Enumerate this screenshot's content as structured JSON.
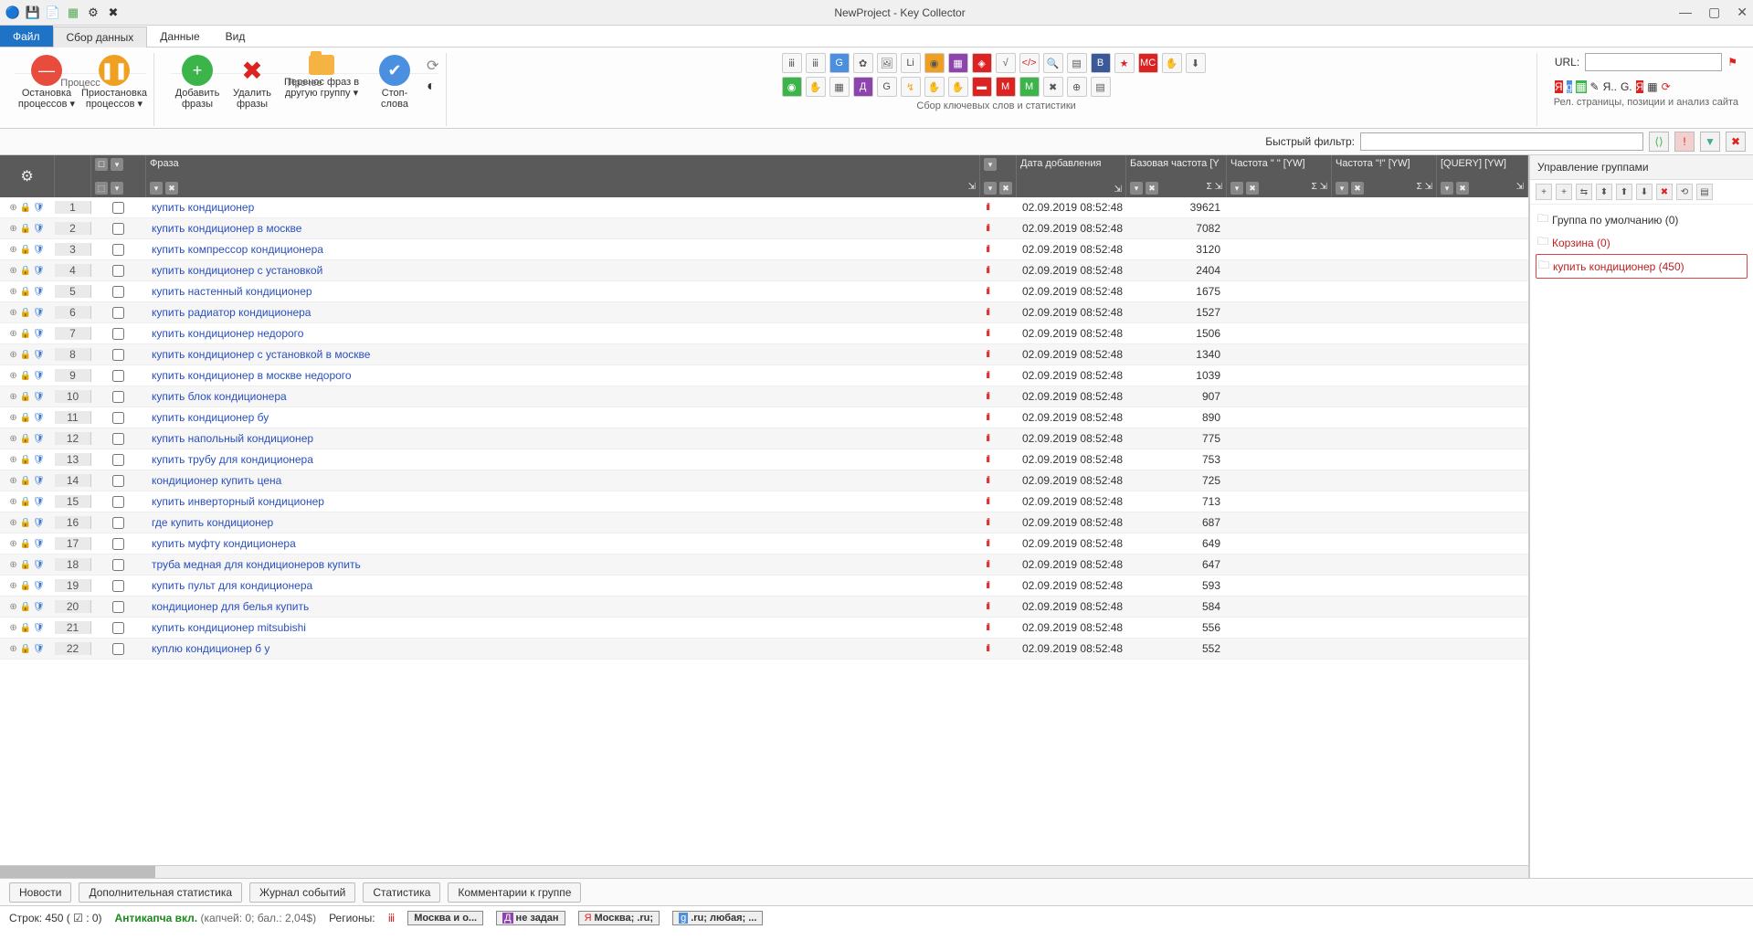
{
  "window": {
    "title": "NewProject - Key Collector"
  },
  "ribbonTabs": {
    "file": "Файл",
    "collect": "Сбор данных",
    "data": "Данные",
    "view": "Вид"
  },
  "ribbon": {
    "process": {
      "stop": "Остановка процессов ▾",
      "pause": "Приостановка процессов ▾",
      "caption": "Процесс"
    },
    "other": {
      "add": "Добавить фразы",
      "del": "Удалить фразы",
      "move": "Перенос фраз в другую группу ▾",
      "stop": "Стоп-слова",
      "caption": "Прочее"
    },
    "keywords_caption": "Сбор ключевых слов и статистики",
    "url_label": "URL:",
    "url_caption": "Рел. страницы, позиции и анализ сайта"
  },
  "filter": {
    "label": "Быстрый фильтр:"
  },
  "columns": {
    "phrase": "Фраза",
    "date": "Дата добавления",
    "base": "Базовая частота [Y",
    "f1": "Частота \" \" [YW]",
    "f2": "Частота \"!\" [YW]",
    "query": "[QUERY] [YW]"
  },
  "rows": [
    {
      "n": 1,
      "phrase": "купить кондиционер",
      "date": "02.09.2019 08:52:48",
      "base": 39621
    },
    {
      "n": 2,
      "phrase": "купить кондиционер в москве",
      "date": "02.09.2019 08:52:48",
      "base": 7082
    },
    {
      "n": 3,
      "phrase": "купить компрессор кондиционера",
      "date": "02.09.2019 08:52:48",
      "base": 3120
    },
    {
      "n": 4,
      "phrase": "купить кондиционер с установкой",
      "date": "02.09.2019 08:52:48",
      "base": 2404
    },
    {
      "n": 5,
      "phrase": "купить настенный кондиционер",
      "date": "02.09.2019 08:52:48",
      "base": 1675
    },
    {
      "n": 6,
      "phrase": "купить радиатор кондиционера",
      "date": "02.09.2019 08:52:48",
      "base": 1527
    },
    {
      "n": 7,
      "phrase": "купить кондиционер недорого",
      "date": "02.09.2019 08:52:48",
      "base": 1506
    },
    {
      "n": 8,
      "phrase": "купить кондиционер с установкой в москве",
      "date": "02.09.2019 08:52:48",
      "base": 1340
    },
    {
      "n": 9,
      "phrase": "купить кондиционер в москве недорого",
      "date": "02.09.2019 08:52:48",
      "base": 1039
    },
    {
      "n": 10,
      "phrase": "купить блок кондиционера",
      "date": "02.09.2019 08:52:48",
      "base": 907
    },
    {
      "n": 11,
      "phrase": "купить кондиционер бу",
      "date": "02.09.2019 08:52:48",
      "base": 890
    },
    {
      "n": 12,
      "phrase": "купить напольный кондиционер",
      "date": "02.09.2019 08:52:48",
      "base": 775
    },
    {
      "n": 13,
      "phrase": "купить трубу для кондиционера",
      "date": "02.09.2019 08:52:48",
      "base": 753
    },
    {
      "n": 14,
      "phrase": "кондиционер купить цена",
      "date": "02.09.2019 08:52:48",
      "base": 725
    },
    {
      "n": 15,
      "phrase": "купить инверторный кондиционер",
      "date": "02.09.2019 08:52:48",
      "base": 713
    },
    {
      "n": 16,
      "phrase": "где купить кондиционер",
      "date": "02.09.2019 08:52:48",
      "base": 687
    },
    {
      "n": 17,
      "phrase": "купить муфту кондиционера",
      "date": "02.09.2019 08:52:48",
      "base": 649
    },
    {
      "n": 18,
      "phrase": "труба медная для кондиционеров купить",
      "date": "02.09.2019 08:52:48",
      "base": 647
    },
    {
      "n": 19,
      "phrase": "купить пульт для кондиционера",
      "date": "02.09.2019 08:52:48",
      "base": 593
    },
    {
      "n": 20,
      "phrase": "кондиционер для белья купить",
      "date": "02.09.2019 08:52:48",
      "base": 584
    },
    {
      "n": 21,
      "phrase": "купить кондиционер mitsubishi",
      "date": "02.09.2019 08:52:48",
      "base": 556
    },
    {
      "n": 22,
      "phrase": "куплю кондиционер б у",
      "date": "02.09.2019 08:52:48",
      "base": 552
    }
  ],
  "groups": {
    "title": "Управление группами",
    "items": [
      {
        "label": "Группа по умолчанию (0)",
        "sel": false,
        "hl": false
      },
      {
        "label": "Корзина (0)",
        "sel": false,
        "hl": true
      },
      {
        "label": "купить кондиционер (450)",
        "sel": true,
        "hl": false
      }
    ]
  },
  "bottomTabs": [
    "Новости",
    "Дополнительная статистика",
    "Журнал событий",
    "Статистика",
    "Комментарии к группе"
  ],
  "status": {
    "rows": "Строк: 450 ( ☑ : 0)",
    "anticaptcha": "Антикапча вкл.",
    "anticaptcha_detail": "(капчей: 0; бал.: 2,04$)",
    "regions_label": "Регионы:",
    "region1": "Москва и о...",
    "region2": "не задан",
    "region3": "Москва; .ru;",
    "region4": ".ru; любая; ..."
  }
}
